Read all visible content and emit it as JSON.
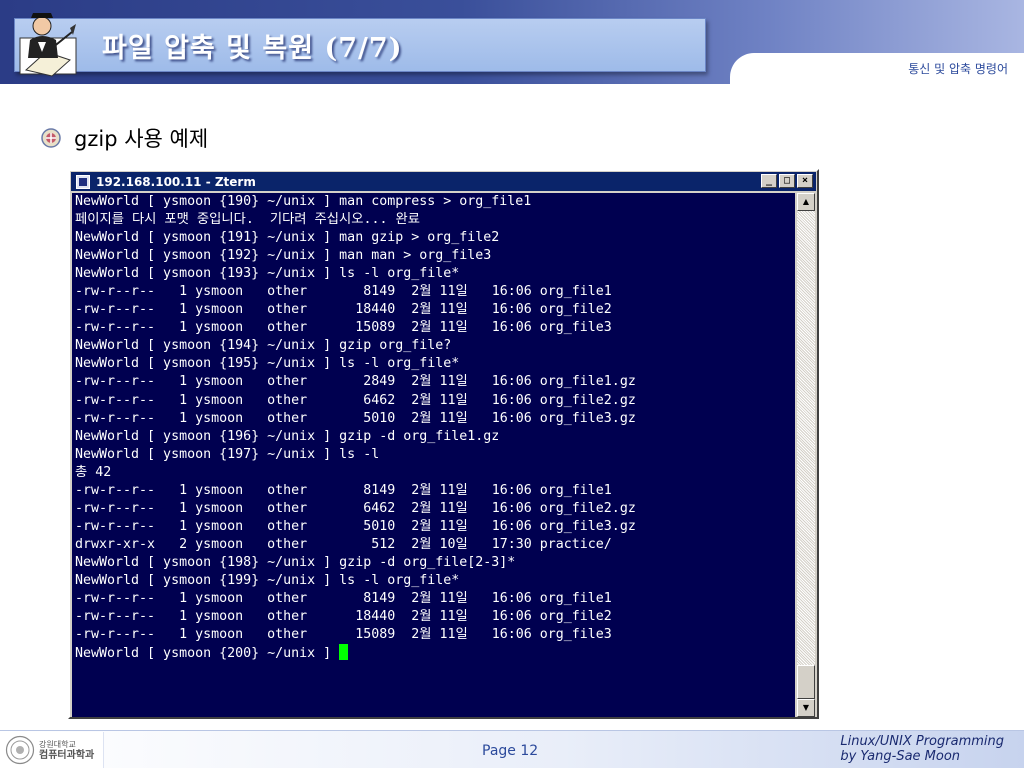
{
  "slide": {
    "title": "파일 압축 및 복원 (7/7)",
    "section_label": "통신 및 압축 명령어",
    "bullet": "gzip 사용 예제"
  },
  "terminal": {
    "window_title": "192.168.100.11 - Zterm",
    "lines": [
      "NewWorld [ ysmoon {190} ~/unix ] man compress > org_file1",
      "페이지를 다시 포맷 중입니다.  기다려 주십시오... 완료",
      "NewWorld [ ysmoon {191} ~/unix ] man gzip > org_file2",
      "NewWorld [ ysmoon {192} ~/unix ] man man > org_file3",
      "NewWorld [ ysmoon {193} ~/unix ] ls -l org_file*",
      "-rw-r--r--   1 ysmoon   other       8149  2월 11일   16:06 org_file1",
      "-rw-r--r--   1 ysmoon   other      18440  2월 11일   16:06 org_file2",
      "-rw-r--r--   1 ysmoon   other      15089  2월 11일   16:06 org_file3",
      "NewWorld [ ysmoon {194} ~/unix ] gzip org_file?",
      "NewWorld [ ysmoon {195} ~/unix ] ls -l org_file*",
      "-rw-r--r--   1 ysmoon   other       2849  2월 11일   16:06 org_file1.gz",
      "-rw-r--r--   1 ysmoon   other       6462  2월 11일   16:06 org_file2.gz",
      "-rw-r--r--   1 ysmoon   other       5010  2월 11일   16:06 org_file3.gz",
      "NewWorld [ ysmoon {196} ~/unix ] gzip -d org_file1.gz",
      "NewWorld [ ysmoon {197} ~/unix ] ls -l",
      "총 42",
      "-rw-r--r--   1 ysmoon   other       8149  2월 11일   16:06 org_file1",
      "-rw-r--r--   1 ysmoon   other       6462  2월 11일   16:06 org_file2.gz",
      "-rw-r--r--   1 ysmoon   other       5010  2월 11일   16:06 org_file3.gz",
      "drwxr-xr-x   2 ysmoon   other        512  2월 10일   17:30 practice/",
      "NewWorld [ ysmoon {198} ~/unix ] gzip -d org_file[2-3]*",
      "NewWorld [ ysmoon {199} ~/unix ] ls -l org_file*",
      "-rw-r--r--   1 ysmoon   other       8149  2월 11일   16:06 org_file1",
      "-rw-r--r--   1 ysmoon   other      18440  2월 11일   16:06 org_file2",
      "-rw-r--r--   1 ysmoon   other      15089  2월 11일   16:06 org_file3",
      "NewWorld [ ysmoon {200} ~/unix ] "
    ],
    "controls": {
      "minimize": "_",
      "maximize": "□",
      "close": "×",
      "scroll_up": "▲",
      "scroll_down": "▼"
    },
    "colors": {
      "background": "#000050",
      "foreground": "#ffffff",
      "cursor": "#00ff00",
      "titlebar": "#0a246a"
    }
  },
  "footer": {
    "org_line1": "강원대학교",
    "org_line2": "컴퓨터과학과",
    "page": "Page 12",
    "credit_line1": "Linux/UNIX Programming",
    "credit_line2": "by Yang-Sae Moon"
  },
  "icons": {
    "header": "scholar-with-quill-icon",
    "bullet": "round-bullet-icon",
    "footer": "university-seal-icon"
  }
}
